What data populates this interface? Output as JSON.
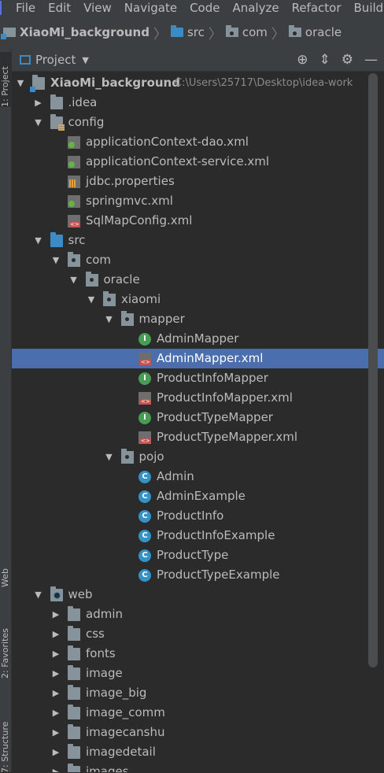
{
  "menu": [
    "File",
    "Edit",
    "View",
    "Navigate",
    "Code",
    "Analyze",
    "Refactor",
    "Build"
  ],
  "breadcrumb": [
    "XiaoMi_background",
    "src",
    "com",
    "oracle"
  ],
  "stripe": {
    "project": "1: Project",
    "web": "Web",
    "favorites": "2: Favorites",
    "structure": "7: Structure"
  },
  "panel": {
    "title": "Project"
  },
  "tree": [
    {
      "label": "XiaoMi_background",
      "hint": "C:\\Users\\25717\\Desktop\\idea-work",
      "icon": "project-folder",
      "arrow": "expanded",
      "depth": 0,
      "bold": true
    },
    {
      "label": ".idea",
      "icon": "folder",
      "arrow": "collapsed",
      "depth": 1
    },
    {
      "label": "config",
      "icon": "config-folder",
      "arrow": "expanded",
      "depth": 1
    },
    {
      "label": "applicationContext-dao.xml",
      "icon": "spring-xml",
      "arrow": "none",
      "depth": 2
    },
    {
      "label": "applicationContext-service.xml",
      "icon": "spring-xml",
      "arrow": "none",
      "depth": 2
    },
    {
      "label": "jdbc.properties",
      "icon": "properties-file",
      "arrow": "none",
      "depth": 2
    },
    {
      "label": "springmvc.xml",
      "icon": "spring-xml",
      "arrow": "none",
      "depth": 2
    },
    {
      "label": "SqlMapConfig.xml",
      "icon": "xml-file",
      "arrow": "none",
      "depth": 2
    },
    {
      "label": "src",
      "icon": "source-folder",
      "arrow": "expanded",
      "depth": 1
    },
    {
      "label": "com",
      "icon": "package",
      "arrow": "expanded",
      "depth": 2
    },
    {
      "label": "oracle",
      "icon": "package",
      "arrow": "expanded",
      "depth": 3
    },
    {
      "label": "xiaomi",
      "icon": "package",
      "arrow": "expanded",
      "depth": 4
    },
    {
      "label": "mapper",
      "icon": "package",
      "arrow": "expanded",
      "depth": 5
    },
    {
      "label": "AdminMapper",
      "icon": "interface",
      "arrow": "none",
      "depth": 6
    },
    {
      "label": "AdminMapper.xml",
      "icon": "xml-file",
      "arrow": "none",
      "depth": 6,
      "selected": true
    },
    {
      "label": "ProductInfoMapper",
      "icon": "interface",
      "arrow": "none",
      "depth": 6
    },
    {
      "label": "ProductInfoMapper.xml",
      "icon": "xml-file",
      "arrow": "none",
      "depth": 6
    },
    {
      "label": "ProductTypeMapper",
      "icon": "interface",
      "arrow": "none",
      "depth": 6
    },
    {
      "label": "ProductTypeMapper.xml",
      "icon": "xml-file",
      "arrow": "none",
      "depth": 6
    },
    {
      "label": "pojo",
      "icon": "package",
      "arrow": "expanded",
      "depth": 5
    },
    {
      "label": "Admin",
      "icon": "class",
      "arrow": "none",
      "depth": 6
    },
    {
      "label": "AdminExample",
      "icon": "class",
      "arrow": "none",
      "depth": 6
    },
    {
      "label": "ProductInfo",
      "icon": "class",
      "arrow": "none",
      "depth": 6
    },
    {
      "label": "ProductInfoExample",
      "icon": "class",
      "arrow": "none",
      "depth": 6
    },
    {
      "label": "ProductType",
      "icon": "class",
      "arrow": "none",
      "depth": 6
    },
    {
      "label": "ProductTypeExample",
      "icon": "class",
      "arrow": "none",
      "depth": 6
    },
    {
      "label": "web",
      "icon": "web-folder",
      "arrow": "expanded",
      "depth": 1
    },
    {
      "label": "admin",
      "icon": "folder",
      "arrow": "collapsed",
      "depth": 2
    },
    {
      "label": "css",
      "icon": "folder",
      "arrow": "collapsed",
      "depth": 2
    },
    {
      "label": "fonts",
      "icon": "folder",
      "arrow": "collapsed",
      "depth": 2
    },
    {
      "label": "image",
      "icon": "folder",
      "arrow": "collapsed",
      "depth": 2
    },
    {
      "label": "image_big",
      "icon": "folder",
      "arrow": "collapsed",
      "depth": 2
    },
    {
      "label": "image_comm",
      "icon": "folder",
      "arrow": "collapsed",
      "depth": 2
    },
    {
      "label": "imagecanshu",
      "icon": "folder",
      "arrow": "collapsed",
      "depth": 2
    },
    {
      "label": "imagedetail",
      "icon": "folder",
      "arrow": "collapsed",
      "depth": 2
    },
    {
      "label": "images",
      "icon": "folder",
      "arrow": "collapsed",
      "depth": 2
    }
  ]
}
